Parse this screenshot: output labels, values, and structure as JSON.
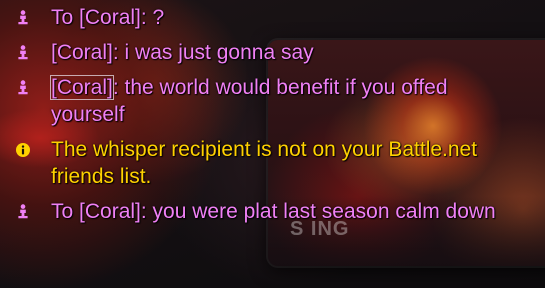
{
  "colors": {
    "whisper": "#f080f5",
    "system": "#ffd100"
  },
  "background": {
    "ghost_text": "S   ING"
  },
  "messages": [
    {
      "type": "whisper",
      "icon": "whisper-person-icon",
      "prefix": "To ",
      "name": "[Coral]",
      "separator": ": ",
      "text": "?"
    },
    {
      "type": "whisper",
      "icon": "whisper-person-icon",
      "prefix": "",
      "name": "[Coral]",
      "separator": ": ",
      "text": "i was just gonna say"
    },
    {
      "type": "whisper",
      "icon": "whisper-person-icon",
      "prefix": "",
      "name": "[Coral]",
      "separator": ": ",
      "text": "the world would benefit if you offed yourself"
    },
    {
      "type": "system",
      "icon": "info-icon",
      "text": "The whisper recipient is not on your Battle.net friends list."
    },
    {
      "type": "whisper",
      "icon": "whisper-person-icon",
      "prefix": "To ",
      "name": "[Coral]",
      "separator": ": ",
      "text": "you were plat last season calm down"
    }
  ]
}
